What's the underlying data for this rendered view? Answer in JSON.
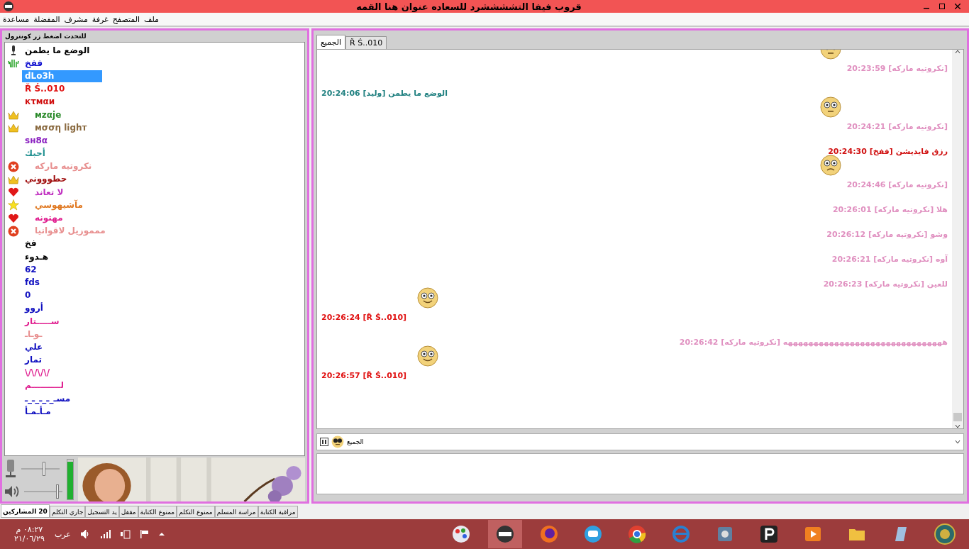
{
  "window": {
    "title": "قروب فيفا التششششرد للسعاده عنوان هنا القمه"
  },
  "menu": [
    "ملف",
    "المتصفح",
    "غرفة",
    "مشرف",
    "المفضلة",
    "مساعدة"
  ],
  "users_panel": {
    "header": "للتحدث اضغط زر كونترول",
    "users": [
      {
        "name": "الوضع ما يطمن",
        "color": "#000000",
        "kind": "mic",
        "selected": false
      },
      {
        "name": "ففخ",
        "color": "#1010d0",
        "kind": "hand",
        "selected": false
      },
      {
        "name": "dLo3h",
        "color": "#ffffff",
        "kind": "none",
        "selected": true
      },
      {
        "name": "Ř Ś..010",
        "color": "#e01010",
        "kind": "none",
        "selected": false
      },
      {
        "name": "кτмαи",
        "color": "#d01010",
        "kind": "none",
        "selected": false
      },
      {
        "name": "мzαje",
        "color": "#2a8a2a",
        "kind": "crown",
        "selected": false
      },
      {
        "name": "мσση lighт",
        "color": "#8a6a40",
        "kind": "crown",
        "selected": false
      },
      {
        "name": "ѕн8α",
        "color": "#8a20c0",
        "kind": "none",
        "selected": false
      },
      {
        "name": "أحبك",
        "color": "#209090",
        "kind": "none",
        "selected": false
      },
      {
        "name": "نكروتيه ماركه",
        "color": "#e89090",
        "kind": "ban",
        "selected": false
      },
      {
        "name": "حطوووني",
        "color": "#a01010",
        "kind": "crown",
        "selected": false
      },
      {
        "name": "لا تعاند",
        "color": "#c030c0",
        "kind": "heart",
        "selected": false
      },
      {
        "name": "مآشيهوسي",
        "color": "#e07820",
        "kind": "star",
        "selected": false
      },
      {
        "name": "مهتونه",
        "color": "#e02090",
        "kind": "heart",
        "selected": false
      },
      {
        "name": "ممموزيل لاقوانيا",
        "color": "#e89090",
        "kind": "ban",
        "selected": false
      },
      {
        "name": "فخ",
        "color": "#000000",
        "kind": "none",
        "selected": false
      },
      {
        "name": "هـدوء",
        "color": "#000000",
        "kind": "none",
        "selected": false
      },
      {
        "name": "62",
        "color": "#1010c0",
        "kind": "none",
        "selected": false
      },
      {
        "name": "fds",
        "color": "#1010c0",
        "kind": "none",
        "selected": false
      },
      {
        "name": "0",
        "color": "#1010c0",
        "kind": "none",
        "selected": false
      },
      {
        "name": "أروو",
        "color": "#1010c0",
        "kind": "none",
        "selected": false
      },
      {
        "name": "ســـــتار",
        "color": "#e02090",
        "kind": "none",
        "selected": false
      },
      {
        "name": "ـوـاـ",
        "color": "#e89090",
        "kind": "none",
        "selected": false
      },
      {
        "name": "علي",
        "color": "#1010c0",
        "kind": "none",
        "selected": false
      },
      {
        "name": "تمار",
        "color": "#1010c0",
        "kind": "none",
        "selected": false
      },
      {
        "name": "\\/\\/\\/\\/",
        "color": "#e02090",
        "kind": "none",
        "selected": false
      },
      {
        "name": "لــــــــــم",
        "color": "#e02090",
        "kind": "none",
        "selected": false
      },
      {
        "name": "مسـ_ـ_ـ_ـ_ـ",
        "color": "#1010c0",
        "kind": "none",
        "selected": false
      },
      {
        "name": "مـأـمـأ",
        "color": "#1010c0",
        "kind": "none",
        "selected": false
      }
    ],
    "mic_slider": {
      "level": 0.6
    },
    "volume_slider": {
      "level": 0.9
    },
    "meter": {
      "level": 0.95
    }
  },
  "chat": {
    "tabs": [
      {
        "label": "Ř Ś..010",
        "selected": false
      },
      {
        "label": "الجميع",
        "selected": true
      }
    ],
    "messages": [
      {
        "text": "20:23:59 [نكروتيه ماركه]",
        "color": "#e090c0",
        "kind": "other",
        "emoticon": {
          "kind": "stare"
        }
      },
      {
        "text": "20:24:06 [وليد] الوضع ما يطمن",
        "color": "#208080",
        "kind": "own"
      },
      {
        "text": "20:24:21 [نكروتيه ماركه]",
        "color": "#e090c0",
        "kind": "other",
        "emoticon": {
          "kind": "stare"
        }
      },
      {
        "text": "20:24:30 [ففخ] رزق فايديشن",
        "color": "#d01010",
        "kind": "other"
      },
      {
        "text": "20:24:46 [نكروتيه ماركه]",
        "color": "#e090c0",
        "kind": "other",
        "emoticon": {
          "kind": "sad"
        }
      },
      {
        "text": "20:26:01 [نكروتيه ماركه] هلا",
        "color": "#e090c0",
        "kind": "other"
      },
      {
        "text": "20:26:12 [نكروتيه ماركه] وشو",
        "color": "#e090c0",
        "kind": "other"
      },
      {
        "text": "20:26:21 [نكروتيه ماركه] آوه",
        "color": "#e090c0",
        "kind": "other"
      },
      {
        "text": "20:26:23 [نكروتيه ماركه] للعين",
        "color": "#e090c0",
        "kind": "other"
      },
      {
        "text": "20:26:24 [Ř Ś..010]",
        "color": "#e01010",
        "kind": "own",
        "emoticon": {
          "kind": "smile"
        }
      },
      {
        "text": "20:26:42 [نكروتيه ماركه] هههههههههههههههههههههههههههههههه",
        "color": "#e090c0",
        "kind": "other"
      },
      {
        "text": "20:26:57 [Ř Ś..010]",
        "color": "#e01010",
        "kind": "own",
        "emoticon": {
          "kind": "smile"
        }
      }
    ],
    "recipient": "الجميع"
  },
  "bottom_tabs": [
    {
      "label": "مراقبة الكتابة",
      "selected": false
    },
    {
      "label": "مراسة المسلم",
      "selected": false
    },
    {
      "label": "ممنوع التكلم",
      "selected": false
    },
    {
      "label": "ممنوع الكتابة",
      "selected": false
    },
    {
      "label": "مقفل",
      "selected": false
    },
    {
      "label": "يد التسجيل",
      "selected": false
    },
    {
      "label": "جاري التكلم",
      "selected": false
    },
    {
      "label": "20 المشاركين",
      "selected": true
    }
  ],
  "taskbar": {
    "language": "عرب",
    "time": "٠٨:٢٧ م",
    "date": "٢١/٠٦/٢٩"
  }
}
